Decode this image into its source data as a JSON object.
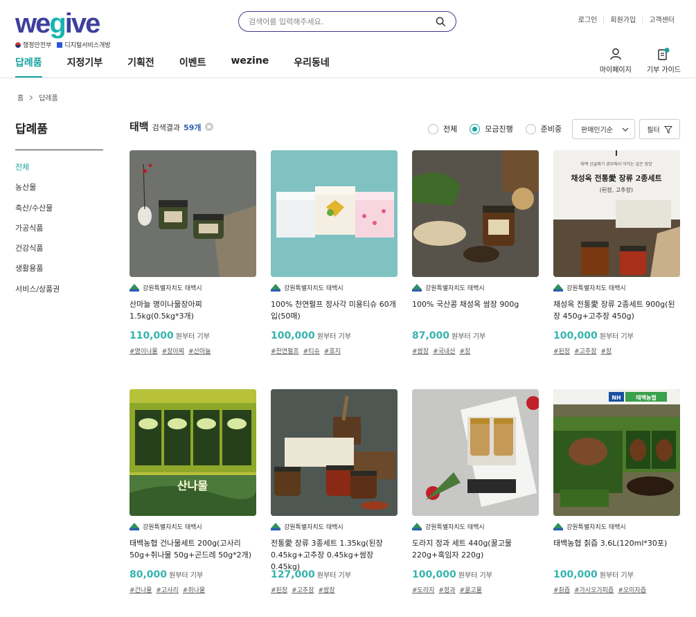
{
  "header": {
    "logo_text_a": "we",
    "logo_text_g": "g",
    "logo_text_b": "ive",
    "logo_sub_ministry": "행정안전부",
    "logo_sub_dept": "디지털서비스개방",
    "search_placeholder": "검색어를 입력해주세요.",
    "toplinks": [
      "로그인",
      "회원가입",
      "고객센터"
    ],
    "nav": [
      "답례품",
      "지정기부",
      "기획전",
      "이벤트",
      "wezine",
      "우리동네"
    ],
    "mypage_label": "마이페이지",
    "guide_label": "기부 가이드"
  },
  "breadcrumb": {
    "home": "홈",
    "current": "답례품"
  },
  "sidebar": {
    "title": "답례품",
    "items": [
      "전체",
      "농산물",
      "축산/수산물",
      "가공식품",
      "건강식품",
      "생활용품",
      "서비스/상품권"
    ]
  },
  "results": {
    "keyword": "태백",
    "label": "검색결과",
    "count": "59개",
    "radio_all": "전체",
    "radio_ongoing": "모금진행",
    "radio_ready": "준비중",
    "sort": "판매인기순",
    "filter": "필터"
  },
  "products": [
    {
      "org": "강원특별자치도 태백시",
      "name": "산마늘 명이나물장아찌 1.5kg(0.5kg*3개)",
      "price": "110,000",
      "unit": "원부터 기부",
      "tags": [
        "#명이나물",
        "#장아찌",
        "#산마늘"
      ]
    },
    {
      "org": "강원특별자치도 태백시",
      "name": "100% 천연펄프 정사각 미용티슈 60개입(50매)",
      "price": "100,000",
      "unit": "원부터 기부",
      "tags": [
        "#천연펄프",
        "#티슈",
        "#휴지"
      ]
    },
    {
      "org": "강원특별자치도 태백시",
      "name": "100% 국산콩 채성옥 쌈장 900g",
      "price": "87,000",
      "unit": "원부터 기부",
      "tags": [
        "#쌈장",
        "#국내산",
        "#장"
      ]
    },
    {
      "org": "강원특별자치도 태백시",
      "name": "채성옥 전통愛 장류 2종세트 900g(된장 450g+고추장 450g)",
      "price": "100,000",
      "unit": "원부터 기부",
      "tags": [
        "#된장",
        "#고추장",
        "#장"
      ]
    },
    {
      "org": "강원특별자치도 태백시",
      "name": "태백농협 건나물세트 200g(고사리 50g+취나물 50g+곤드레 50g*2개)",
      "price": "80,000",
      "unit": "원부터 기부",
      "tags": [
        "#건나물",
        "#고사리",
        "#취나물"
      ]
    },
    {
      "org": "강원특별자치도 태백시",
      "name": "전통愛 장류 3종세트 1.35kg(된장 0.45kg+고추장 0.45kg+쌈장 0.45kg)",
      "price": "127,000",
      "unit": "원부터 기부",
      "tags": [
        "#된장",
        "#고추장",
        "#쌈장"
      ]
    },
    {
      "org": "강원특별자치도 태백시",
      "name": "도라지 정과 세트 440g(꿀고물 220g+흑임자 220g)",
      "price": "100,000",
      "unit": "원부터 기부",
      "tags": [
        "#도라지",
        "#정과",
        "#꿀고물"
      ]
    },
    {
      "org": "강원특별자치도 태백시",
      "name": "태백농협 칡즙 3.6L(120ml*30포)",
      "price": "100,000",
      "unit": "원부터 기부",
      "tags": [
        "#칡즙",
        "#가시오가피즙",
        "#오미자즙"
      ]
    }
  ],
  "thumb_text": {
    "p4_top": "태백 산골짜기 광부에서 익히는 깊은 장맛",
    "p4_title": "채성옥 전통愛 장류 2종세트",
    "p4_sub": "(된장, 고추장)",
    "p5_label": "산나물",
    "p8_nh": "NH",
    "p8_brand": "태백농협"
  },
  "colors": {
    "accent": "#17a3a0",
    "price": "#36b3ae",
    "brand": "#3f3f9e"
  }
}
